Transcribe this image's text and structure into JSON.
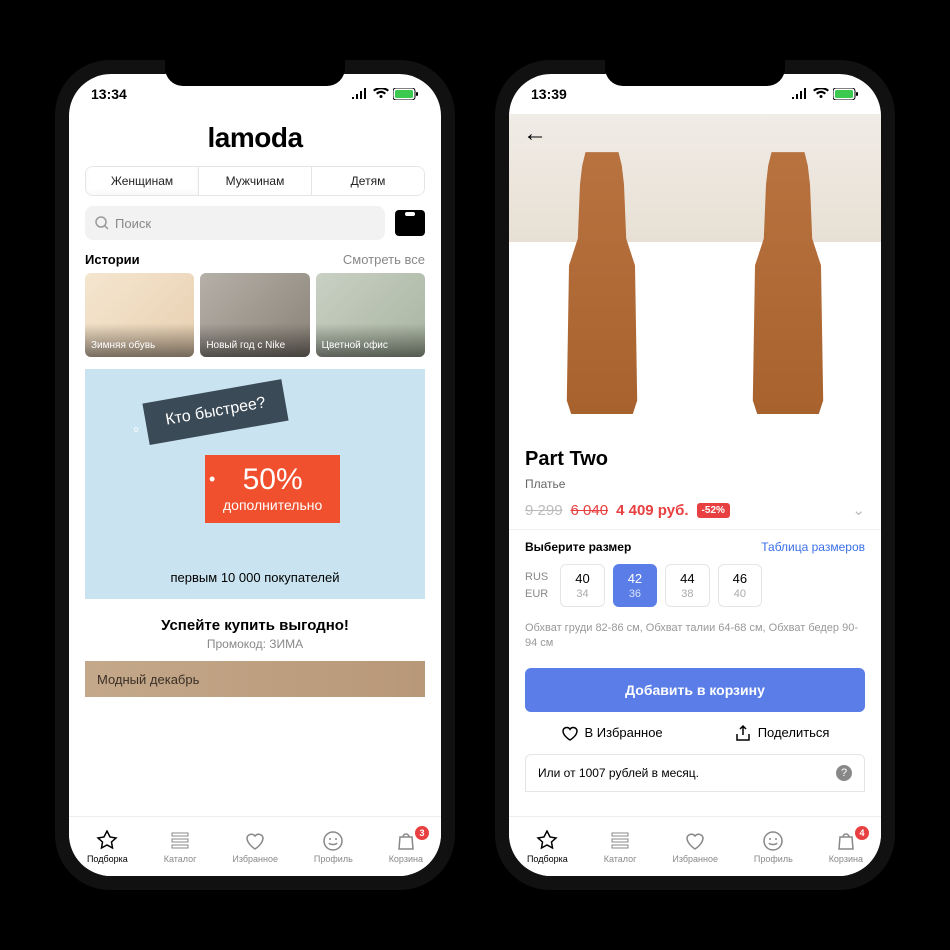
{
  "phone1": {
    "status_time": "13:34",
    "logo": "lamoda",
    "tabs": [
      "Женщинам",
      "Мужчинам",
      "Детям"
    ],
    "search_placeholder": "Поиск",
    "stories_title": "Истории",
    "stories_link": "Смотреть все",
    "stories": [
      "Зимняя обувь",
      "Новый год с Nike",
      "Цветной офис"
    ],
    "promo": {
      "tag1": "Кто быстрее?",
      "tag2_big": "50%",
      "tag2_small": "дополнительно",
      "sub": "первым 10 000 покупателей"
    },
    "deal_title": "Успейте купить выгодно!",
    "deal_promo": "Промокод: ЗИМА",
    "banner": "Модный декабрь",
    "nav": [
      "Подборка",
      "Каталог",
      "Избранное",
      "Профиль",
      "Корзина"
    ],
    "cart_badge": "3"
  },
  "phone2": {
    "status_time": "13:39",
    "brand": "Part Two",
    "product_type": "Платье",
    "price_old1": "9 299",
    "price_old2": "6 040",
    "price": "4 409 руб.",
    "discount": "-52%",
    "size_title": "Выберите размер",
    "size_table": "Таблица размеров",
    "size_systems": [
      "RUS",
      "EUR"
    ],
    "sizes": [
      {
        "rus": "40",
        "eur": "34",
        "selected": false
      },
      {
        "rus": "42",
        "eur": "36",
        "selected": true
      },
      {
        "rus": "44",
        "eur": "38",
        "selected": false
      },
      {
        "rus": "46",
        "eur": "40",
        "selected": false
      }
    ],
    "measurements": "Обхват груди 82-86 см, Обхват талии 64-68 см, Обхват бедер 90-94 см",
    "add_button": "Добавить в корзину",
    "fav_label": "В Избранное",
    "share_label": "Поделиться",
    "installment": "Или от 1007 рублей в месяц.",
    "nav": [
      "Подборка",
      "Каталог",
      "Избранное",
      "Профиль",
      "Корзина"
    ],
    "cart_badge": "4"
  }
}
